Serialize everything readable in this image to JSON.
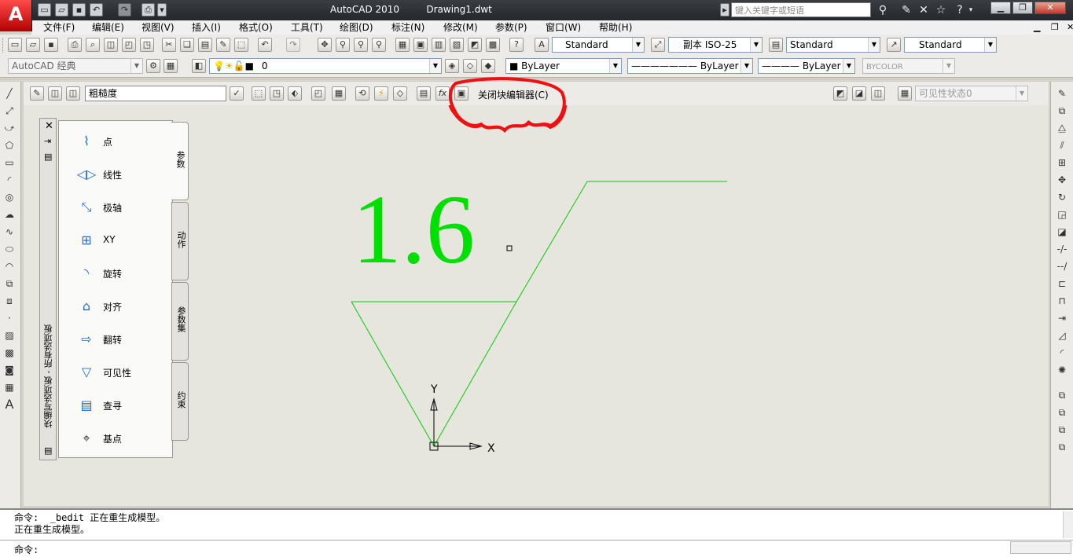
{
  "title_bar": {
    "app_name": "AutoCAD 2010",
    "document": "Drawing1.dwt",
    "search_placeholder": "键入关键字或短语",
    "logo_letter": "A"
  },
  "menu": [
    "文件(F)",
    "编辑(E)",
    "视图(V)",
    "插入(I)",
    "格式(O)",
    "工具(T)",
    "绘图(D)",
    "标注(N)",
    "修改(M)",
    "参数(P)",
    "窗口(W)",
    "帮助(H)"
  ],
  "styles_toolbar": {
    "text_style": "Standard",
    "dim_style": "副本 ISO-25",
    "table_style": "Standard",
    "multileader_style": "Standard"
  },
  "layers_toolbar": {
    "workspace": "AutoCAD 经典",
    "layer": "0",
    "color": "ByLayer",
    "linetype": "ByLayer",
    "lineweight": "ByLayer",
    "plotstyle": "BYCOLOR"
  },
  "block_editor": {
    "block_name": "粗糙度",
    "close_label": "关闭块编辑器(C)",
    "visibility_state": "可见性状态0"
  },
  "palette": {
    "title": "块编写选项板 - 所有选项板",
    "tabs": [
      "参数",
      "动作",
      "参数集",
      "约束"
    ],
    "items": [
      "点",
      "线性",
      "极轴",
      "XY",
      "旋转",
      "对齐",
      "翻转",
      "可见性",
      "查寻",
      "基点"
    ]
  },
  "drawing": {
    "text": "1.6",
    "axis_y": "Y",
    "axis_x": "X"
  },
  "command": {
    "line1": "命令:  _bedit 正在重生成模型。",
    "line2": "正在重生成模型。",
    "prompt": "命令:"
  }
}
